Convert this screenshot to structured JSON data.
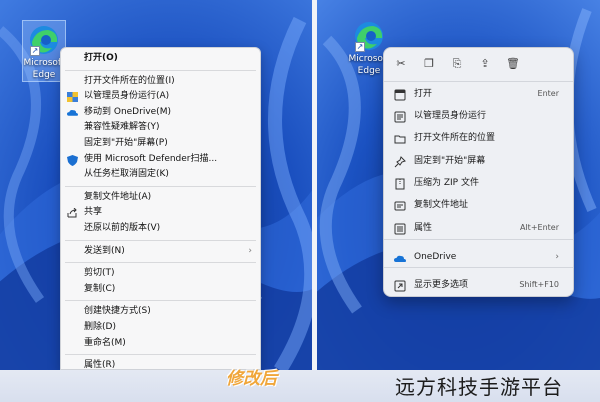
{
  "desktop_icon": {
    "line1": "Microsoft",
    "line2": "Edge"
  },
  "classic_menu": {
    "items": [
      {
        "label": "打开(O)",
        "bold": true,
        "icon": ""
      },
      {
        "sep": true
      },
      {
        "label": "打开文件所在的位置(I)",
        "icon": ""
      },
      {
        "label": "以管理员身份运行(A)",
        "icon": "shield-icon"
      },
      {
        "label": "移动到 OneDrive(M)",
        "icon": "onedrive-icon"
      },
      {
        "label": "兼容性疑难解答(Y)",
        "icon": ""
      },
      {
        "label": "固定到\"开始\"屏幕(P)",
        "icon": ""
      },
      {
        "label": "使用 Microsoft Defender扫描...",
        "icon": "defender-icon"
      },
      {
        "label": "从任务栏取消固定(K)",
        "icon": ""
      },
      {
        "sep": true
      },
      {
        "label": "复制文件地址(A)",
        "icon": ""
      },
      {
        "label": "共享",
        "icon": "share-icon"
      },
      {
        "label": "还原以前的版本(V)",
        "icon": ""
      },
      {
        "sep": true
      },
      {
        "label": "发送到(N)",
        "icon": "",
        "submenu": true
      },
      {
        "sep": true
      },
      {
        "label": "剪切(T)",
        "icon": ""
      },
      {
        "label": "复制(C)",
        "icon": ""
      },
      {
        "sep": true
      },
      {
        "label": "创建快捷方式(S)",
        "icon": ""
      },
      {
        "label": "删除(D)",
        "icon": ""
      },
      {
        "label": "重命名(M)",
        "icon": ""
      },
      {
        "sep": true
      },
      {
        "label": "属性(R)",
        "icon": ""
      }
    ]
  },
  "modern_menu": {
    "toolbar": [
      "cut-icon",
      "copy-icon",
      "rename-icon",
      "share-icon",
      "delete-icon"
    ],
    "items": [
      {
        "label": "打开",
        "shortcut": "Enter",
        "icon": "open-icon"
      },
      {
        "label": "以管理员身份运行",
        "shortcut": "",
        "icon": "admin-icon"
      },
      {
        "label": "打开文件所在的位置",
        "shortcut": "",
        "icon": "folder-icon"
      },
      {
        "label": "固定到\"开始\"屏幕",
        "shortcut": "",
        "icon": "pin-icon"
      },
      {
        "label": "压缩为 ZIP 文件",
        "shortcut": "",
        "icon": "zip-icon"
      },
      {
        "label": "复制文件地址",
        "shortcut": "",
        "icon": "copy-path-icon"
      },
      {
        "label": "属性",
        "shortcut": "Alt+Enter",
        "icon": "properties-icon"
      },
      {
        "label": "OneDrive",
        "shortcut": "",
        "icon": "onedrive-icon",
        "submenu": true
      },
      {
        "label": "显示更多选项",
        "shortcut": "Shift+F10",
        "icon": "more-options-icon"
      }
    ]
  },
  "watermark": {
    "left": "修改后",
    "right": "远方科技手游平台"
  }
}
